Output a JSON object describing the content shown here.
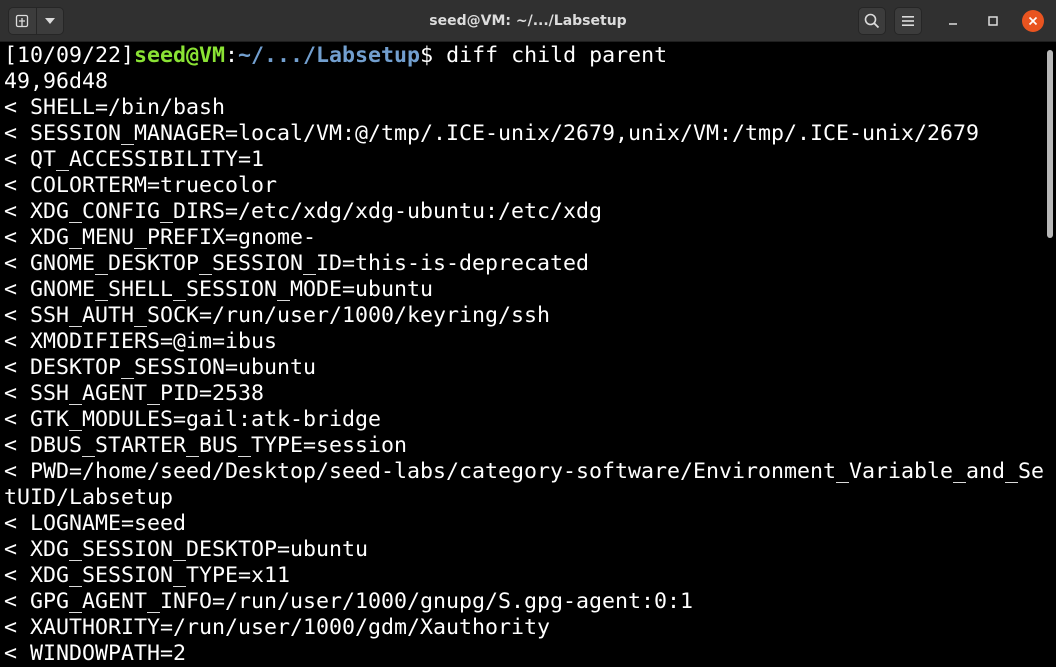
{
  "window": {
    "title": "seed@VM: ~/.../Labsetup"
  },
  "toolbar": {
    "new_tab_icon": "new-tab-icon",
    "menu_dropdown_icon": "chevron-down-icon",
    "search_icon": "search-icon",
    "hamburger_icon": "hamburger-menu-icon",
    "minimize_icon": "minimize-icon",
    "maximize_icon": "maximize-icon",
    "close_icon": "close-icon"
  },
  "colors": {
    "title_bar": "#303030",
    "background": "#000000",
    "text": "#ffffff",
    "prompt_user": "#8ae234",
    "prompt_path": "#729fcf",
    "close_button": "#e95420"
  },
  "terminal": {
    "prompt": {
      "timestamp": "[10/09/22]",
      "user_host": "seed@VM",
      "separator": ":",
      "path": "~/.../Labsetup",
      "dollar": "$ ",
      "command": "diff child parent"
    },
    "lines": [
      "49,96d48",
      "< SHELL=/bin/bash",
      "< SESSION_MANAGER=local/VM:@/tmp/.ICE-unix/2679,unix/VM:/tmp/.ICE-unix/2679",
      "< QT_ACCESSIBILITY=1",
      "< COLORTERM=truecolor",
      "< XDG_CONFIG_DIRS=/etc/xdg/xdg-ubuntu:/etc/xdg",
      "< XDG_MENU_PREFIX=gnome-",
      "< GNOME_DESKTOP_SESSION_ID=this-is-deprecated",
      "< GNOME_SHELL_SESSION_MODE=ubuntu",
      "< SSH_AUTH_SOCK=/run/user/1000/keyring/ssh",
      "< XMODIFIERS=@im=ibus",
      "< DESKTOP_SESSION=ubuntu",
      "< SSH_AGENT_PID=2538",
      "< GTK_MODULES=gail:atk-bridge",
      "< DBUS_STARTER_BUS_TYPE=session",
      "< PWD=/home/seed/Desktop/seed-labs/category-software/Environment_Variable_and_Se",
      "tUID/Labsetup",
      "< LOGNAME=seed",
      "< XDG_SESSION_DESKTOP=ubuntu",
      "< XDG_SESSION_TYPE=x11",
      "< GPG_AGENT_INFO=/run/user/1000/gnupg/S.gpg-agent:0:1",
      "< XAUTHORITY=/run/user/1000/gdm/Xauthority",
      "< WINDOWPATH=2"
    ]
  }
}
